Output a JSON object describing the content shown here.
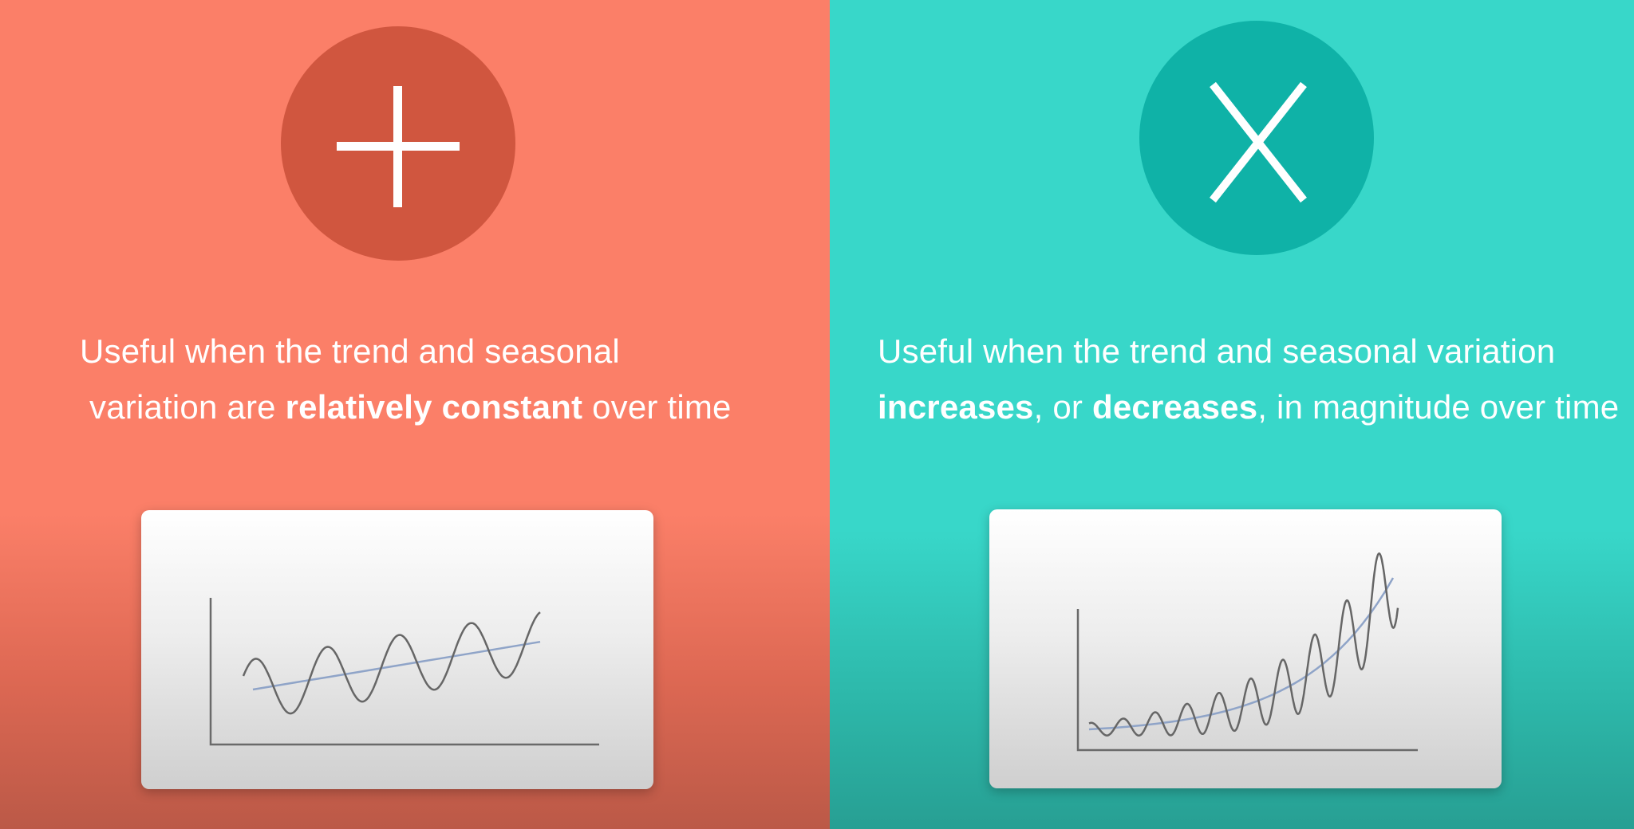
{
  "additive": {
    "symbol": "plus",
    "circle_color": "#d0563f",
    "background_color": "#fb7f68",
    "description": {
      "line1": "Useful when the trend and seasonal",
      "line2_pre": "variation are ",
      "line2_bold": "relatively constant",
      "line2_post": " over time"
    },
    "chart": {
      "trend": "linear",
      "seasonal_amplitude": "constant"
    }
  },
  "multiplicative": {
    "symbol": "X",
    "circle_color": "#0fb2a7",
    "background_color": "#38d7c9",
    "description": {
      "line1": "Useful when the trend and seasonal variation",
      "bold1": "increases",
      "mid": ", or ",
      "bold2": "decreases",
      "end": ", in magnitude over time"
    },
    "chart": {
      "trend": "exponential",
      "seasonal_amplitude": "increasing"
    }
  },
  "colors": {
    "series_line": "#666666",
    "trend_line": "#8fa4c8",
    "axis": "#6a6a6a"
  }
}
